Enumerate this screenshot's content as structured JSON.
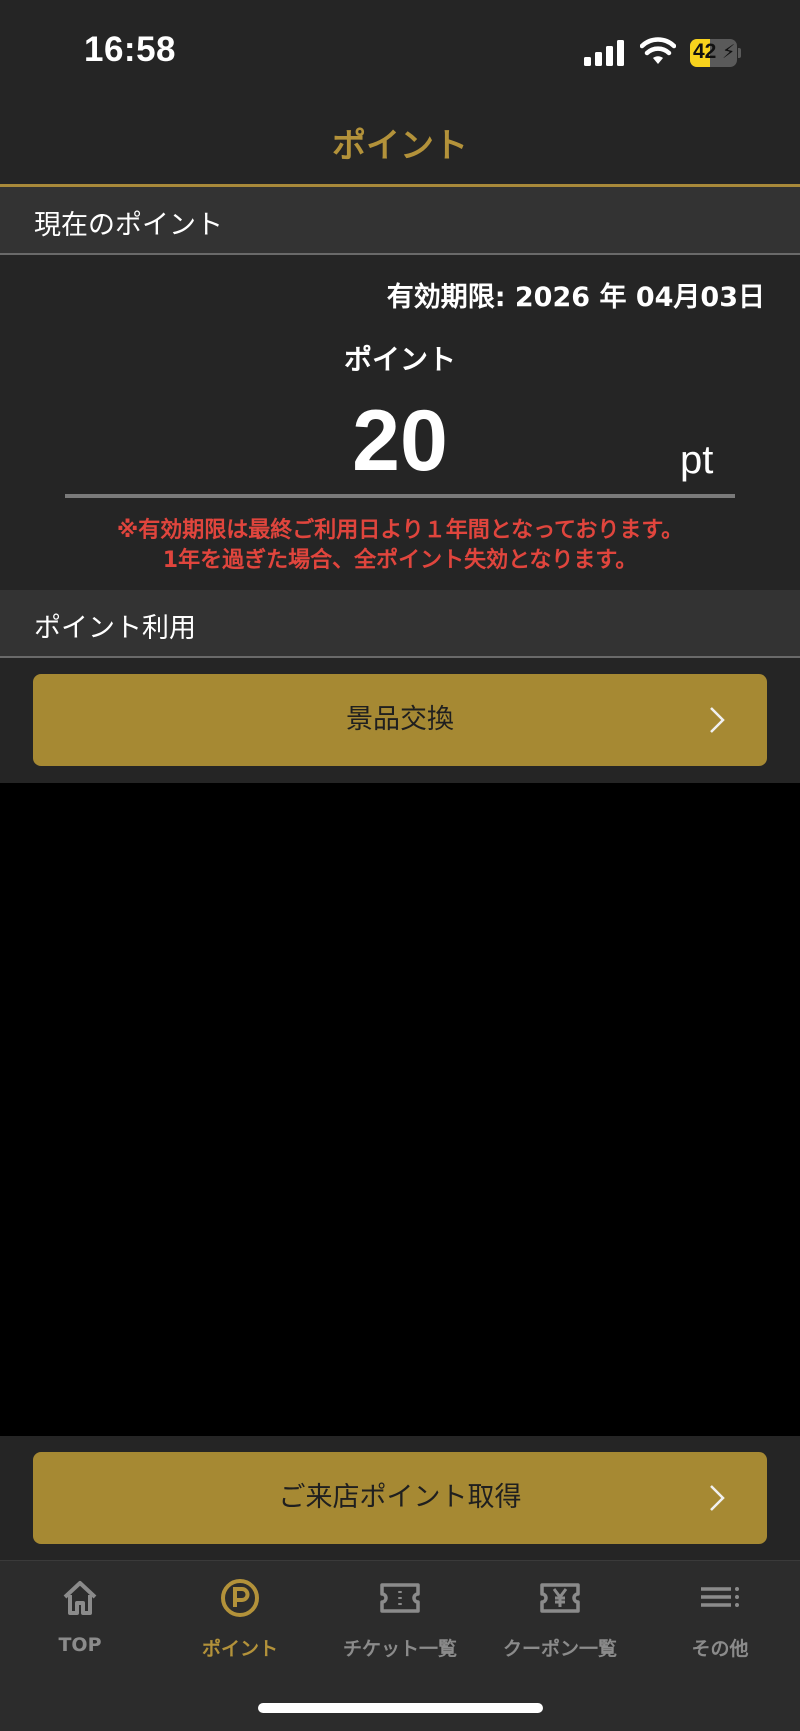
{
  "status_bar": {
    "time": "16:58",
    "battery": "42",
    "battery_level": 0.42
  },
  "header": {
    "title": "ポイント"
  },
  "current_points_section": {
    "heading": "現在のポイント",
    "expiry_text": "有効期限: 2026 年 04月03日",
    "points_label": "ポイント",
    "points_value": "20",
    "points_unit": "pt",
    "warning_line1": "※有効期限は最終ご利用日より１年間となっております。",
    "warning_line2": "1年を過ぎた場合、全ポイント失効となります。"
  },
  "point_usage_section": {
    "heading": "ポイント利用",
    "exchange_button": "景品交換"
  },
  "visit_points_button": "ご来店ポイント取得",
  "tab_bar": {
    "items": [
      {
        "label": "TOP",
        "icon": "home-icon",
        "active": false
      },
      {
        "label": "ポイント",
        "icon": "point-p-icon",
        "active": true
      },
      {
        "label": "チケット一覧",
        "icon": "ticket-icon",
        "active": false
      },
      {
        "label": "クーポン一覧",
        "icon": "coupon-yen-icon",
        "active": false
      },
      {
        "label": "その他",
        "icon": "menu-icon",
        "active": false
      }
    ]
  },
  "colors": {
    "accent": "#b3923a",
    "button": "#a68933",
    "warning": "#e0453d",
    "background": "#252525"
  }
}
